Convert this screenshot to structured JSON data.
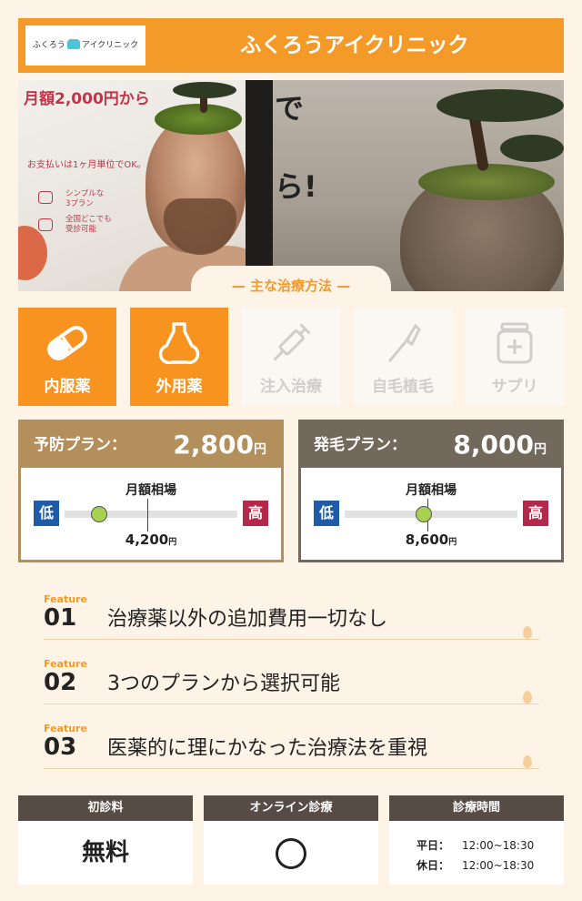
{
  "header": {
    "logo_text_a": "ふくろう",
    "logo_text_b": "アイクリニック",
    "title": "ふくろうアイクリニック"
  },
  "hero": {
    "headline": "月額2,000円から",
    "payment_note": "お支払いは1ヶ月単位でOK。",
    "items": [
      "シンプルな",
      "3プラン",
      "全国どこでも",
      "受診可能"
    ],
    "overlay_1": "で",
    "overlay_2": "ら!"
  },
  "section_title": "— 主な治療方法 —",
  "treatments": [
    {
      "label": "内服薬",
      "icon": "pill-icon",
      "active": true
    },
    {
      "label": "外用薬",
      "icon": "bottle-icon",
      "active": true
    },
    {
      "label": "注入治療",
      "icon": "syringe-icon",
      "active": false
    },
    {
      "label": "自毛植毛",
      "icon": "scalpel-icon",
      "active": false
    },
    {
      "label": "サプリ",
      "icon": "supplement-icon",
      "active": false
    }
  ],
  "plans": [
    {
      "name": "予防プラン：",
      "price": "2,800",
      "price_unit": "円",
      "market_label": "月額相場",
      "low": "低",
      "high": "高",
      "average": "4,200",
      "average_unit": "円",
      "knob_fraction": 0.2,
      "tick_fraction": 0.48
    },
    {
      "name": "発毛プラン：",
      "price": "8,000",
      "price_unit": "円",
      "market_label": "月額相場",
      "low": "低",
      "high": "高",
      "average": "8,600",
      "average_unit": "円",
      "knob_fraction": 0.46,
      "tick_fraction": 0.48
    }
  ],
  "features": [
    {
      "tag": "Feature",
      "num": "01",
      "text": "治療薬以外の追加費用一切なし"
    },
    {
      "tag": "Feature",
      "num": "02",
      "text": "3つのプランから選択可能"
    },
    {
      "tag": "Feature",
      "num": "03",
      "text": "医薬的に理にかなった治療法を重視"
    }
  ],
  "info": {
    "first_visit": {
      "title": "初診料",
      "value": "無料"
    },
    "online": {
      "title": "オンライン診療",
      "value": "○"
    },
    "hours": {
      "title": "診療時間",
      "weekday_label": "平日：",
      "weekday": "12:00~18:30",
      "holiday_label": "休日：",
      "holiday": "12:00~18:30"
    }
  },
  "colors": {
    "accent": "#f39a28",
    "tile_on": "#f7931e",
    "plan_brown": "#b38f5c",
    "plan_dark": "#72685b",
    "low_blue": "#1e5ba8",
    "high_red": "#b5284a",
    "knob_green": "#a6d24f",
    "info_head": "#574c45"
  }
}
